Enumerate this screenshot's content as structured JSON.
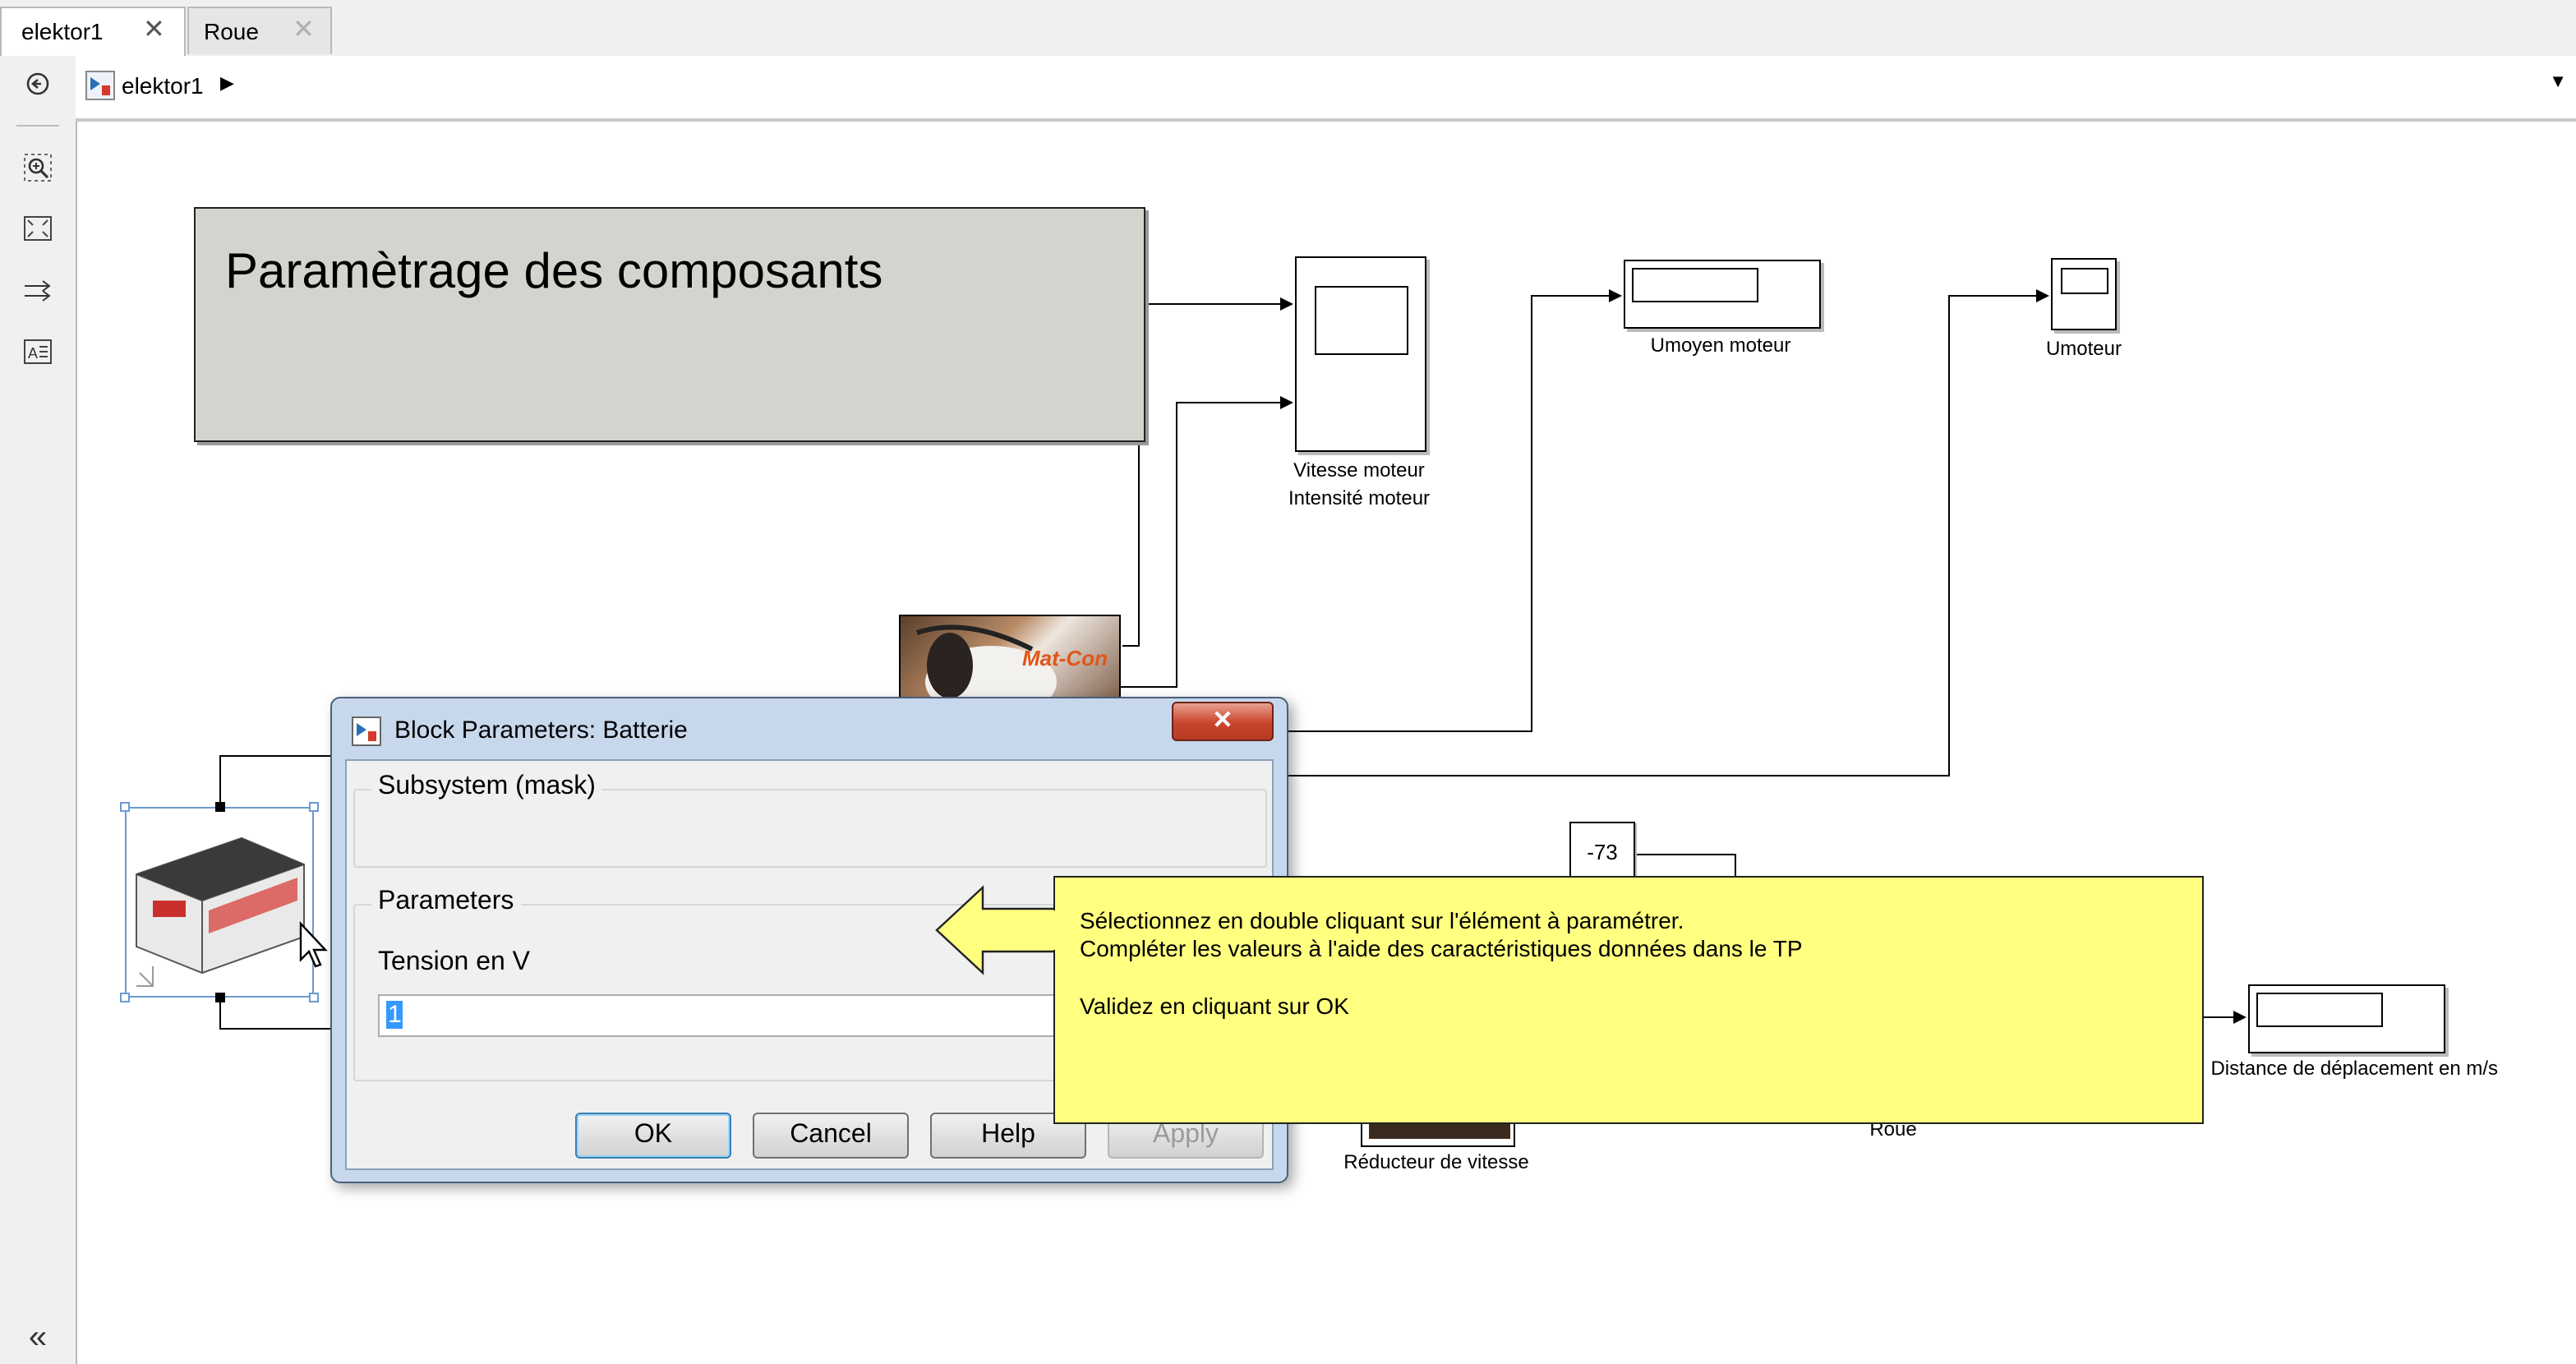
{
  "tabs": [
    {
      "label": "elektor1",
      "active": true
    },
    {
      "label": "Roue",
      "active": false
    }
  ],
  "address": {
    "model_name": "elektor1"
  },
  "diagram": {
    "annotation_title": "Paramètrage des composants",
    "blocks": {
      "scope_label_line1": "Vitesse moteur",
      "scope_label_line2": "Intensité moteur",
      "umoyen": "Umoyen moteur",
      "umoteur": "Umoteur",
      "constant_value": "-73",
      "distance": "Distance de déplacement en m/s",
      "reducteur": "Réducteur de vitesse",
      "roue": "Roue",
      "motor_logo": "Mat-Con"
    }
  },
  "dialog": {
    "title": "Block Parameters: Batterie",
    "section_mask": "Subsystem (mask)",
    "section_params": "Parameters",
    "param_label": "Tension en V",
    "param_value": "1",
    "buttons": {
      "ok": "OK",
      "cancel": "Cancel",
      "help": "Help",
      "apply": "Apply"
    }
  },
  "callout": {
    "line1": "Sélectionnez en double cliquant sur l'élément à paramétrer.",
    "line2": "Compléter les valeurs à l'aide des caractéristiques données dans le TP",
    "line3": "Validez en cliquant sur OK",
    "bg_color": "#ffff80"
  },
  "icons": {
    "close_tab": "✕",
    "back": "⊕",
    "collapse": "«",
    "dropdown": "▼",
    "breadcrumb_arrow": "▶"
  }
}
